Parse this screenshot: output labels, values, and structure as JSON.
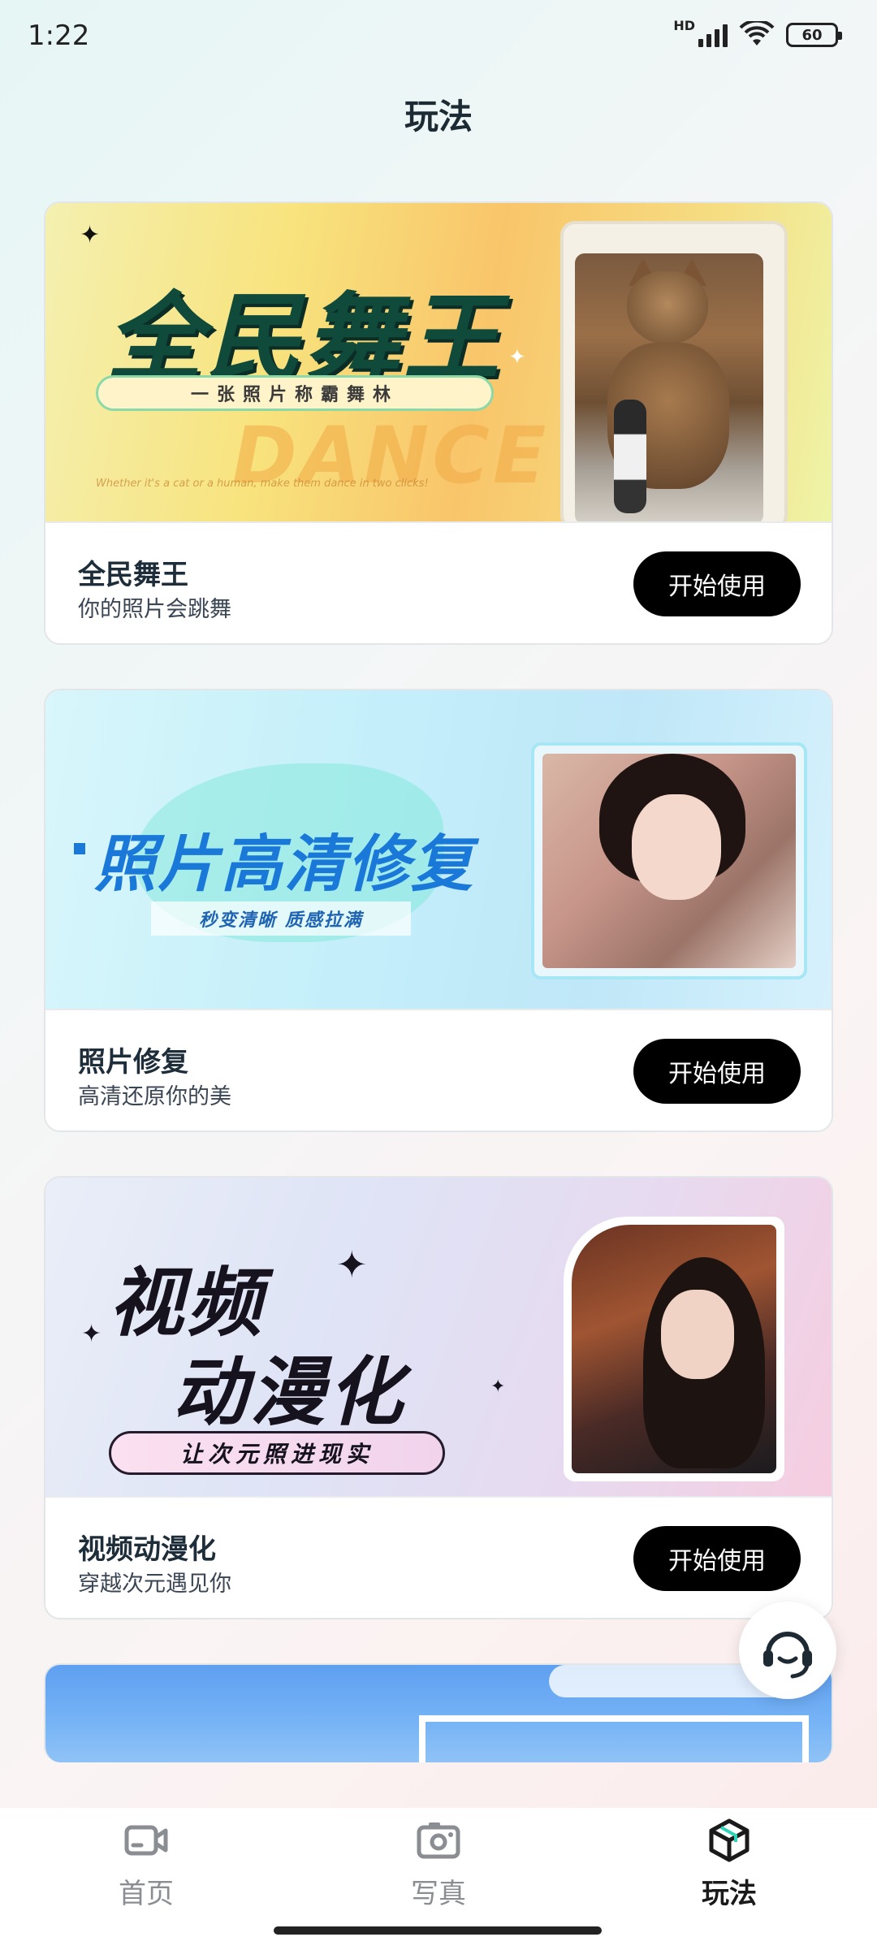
{
  "status_bar": {
    "time": "1:22",
    "network_badge": "HD",
    "battery": "60"
  },
  "page": {
    "title": "玩法"
  },
  "cards": [
    {
      "title": "全民舞王",
      "subtitle": "你的照片会跳舞",
      "button": "开始使用",
      "banner": {
        "headline": "全民舞王",
        "tagline": "一张照片称霸舞林",
        "watermark": "DANCE",
        "tiny_text": "Whether it's a cat or a human, make them dance in two clicks!"
      }
    },
    {
      "title": "照片修复",
      "subtitle": "高清还原你的美",
      "button": "开始使用",
      "banner": {
        "headline": "照片高清修复",
        "tagline": "秒变清晰  质感拉满"
      }
    },
    {
      "title": "视频动漫化",
      "subtitle": "穿越次元遇见你",
      "button": "开始使用",
      "banner": {
        "headline_line1": "视频",
        "headline_line2": "动漫化",
        "tagline": "让次元照进现实"
      }
    }
  ],
  "bottom_nav": {
    "items": [
      {
        "label": "首页",
        "icon": "video-camera-icon",
        "active": false
      },
      {
        "label": "写真",
        "icon": "camera-icon",
        "active": false
      },
      {
        "label": "玩法",
        "icon": "cube-icon",
        "active": true
      }
    ]
  },
  "floating": {
    "icon": "customer-service-icon"
  },
  "colors": {
    "accent_button": "#000000",
    "active_nav": "#1a1a1a",
    "inactive_nav": "#8a8e92"
  }
}
